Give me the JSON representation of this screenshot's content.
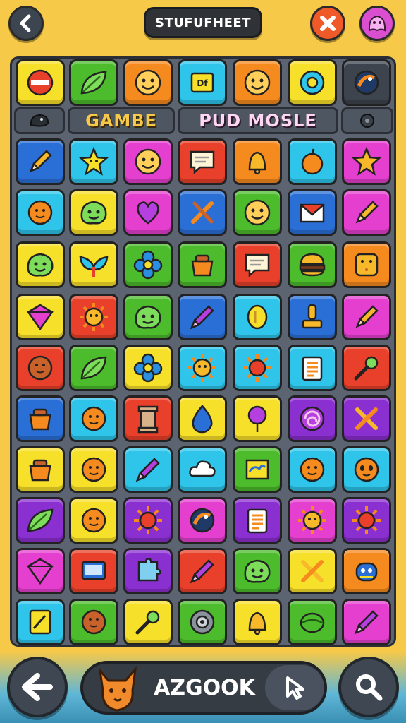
{
  "header": {
    "title": "STUFUFHEET"
  },
  "category_tabs": {
    "left": "GAMBE",
    "right": "PUD MOSLE"
  },
  "footer": {
    "label": "AZGOOK"
  },
  "colors": {
    "yellow": "#f7e02a",
    "orange": "#f58a1f",
    "red": "#e8402a",
    "green": "#4cbb2c",
    "cyan": "#2fc4ea",
    "blue": "#2a6fd6",
    "magenta": "#e43fcf",
    "purple": "#8a2fd0",
    "darkgray": "#3d444e"
  },
  "grid": [
    [
      {
        "c": "yellow",
        "i": "stop-icon"
      },
      {
        "c": "green",
        "i": "leaf-icon"
      },
      {
        "c": "orange",
        "i": "smiley-icon"
      },
      {
        "c": "cyan",
        "i": "sign-icon"
      },
      {
        "c": "orange",
        "i": "smiley-icon"
      },
      {
        "c": "yellow",
        "i": "gear-flower-icon"
      },
      {
        "c": "darkgray",
        "i": "orb-icon"
      }
    ],
    [
      {
        "c": "blue",
        "i": "pencil-icon"
      },
      {
        "c": "cyan",
        "i": "star-face-icon"
      },
      {
        "c": "magenta",
        "i": "smiley-icon"
      },
      {
        "c": "red",
        "i": "chat-icon"
      },
      {
        "c": "orange",
        "i": "bell-icon"
      },
      {
        "c": "cyan",
        "i": "apple-icon"
      },
      {
        "c": "magenta",
        "i": "star-icon"
      }
    ],
    [
      {
        "c": "cyan",
        "i": "ball-icon"
      },
      {
        "c": "yellow",
        "i": "blob-face-icon"
      },
      {
        "c": "magenta",
        "i": "heart-icon"
      },
      {
        "c": "blue",
        "i": "tools-icon"
      },
      {
        "c": "green",
        "i": "smiley-icon"
      },
      {
        "c": "blue",
        "i": "mail-icon"
      },
      {
        "c": "magenta",
        "i": "pencil-icon"
      }
    ],
    [
      {
        "c": "yellow",
        "i": "blob-face-icon"
      },
      {
        "c": "yellow",
        "i": "wings-icon"
      },
      {
        "c": "green",
        "i": "flower-icon"
      },
      {
        "c": "green",
        "i": "pot-icon"
      },
      {
        "c": "red",
        "i": "chat-icon"
      },
      {
        "c": "green",
        "i": "burger-icon"
      },
      {
        "c": "orange",
        "i": "cracker-icon"
      }
    ],
    [
      {
        "c": "yellow",
        "i": "gem-icon"
      },
      {
        "c": "red",
        "i": "sun-face-icon"
      },
      {
        "c": "green",
        "i": "blob-face-icon"
      },
      {
        "c": "blue",
        "i": "crayon-icon"
      },
      {
        "c": "cyan",
        "i": "coin-icon"
      },
      {
        "c": "blue",
        "i": "stamp-icon"
      },
      {
        "c": "magenta",
        "i": "pencil-icon"
      }
    ],
    [
      {
        "c": "red",
        "i": "cookie-icon"
      },
      {
        "c": "green",
        "i": "leaf-icon"
      },
      {
        "c": "yellow",
        "i": "flower-icon"
      },
      {
        "c": "cyan",
        "i": "sun-face-icon"
      },
      {
        "c": "cyan",
        "i": "sun-icon"
      },
      {
        "c": "cyan",
        "i": "list-icon"
      },
      {
        "c": "red",
        "i": "key-icon"
      }
    ],
    [
      {
        "c": "blue",
        "i": "pot-icon"
      },
      {
        "c": "cyan",
        "i": "ball-icon"
      },
      {
        "c": "red",
        "i": "pillar-icon"
      },
      {
        "c": "yellow",
        "i": "drop-icon"
      },
      {
        "c": "yellow",
        "i": "balloon-icon"
      },
      {
        "c": "purple",
        "i": "swirl-icon"
      },
      {
        "c": "purple",
        "i": "cross-tools-icon"
      }
    ],
    [
      {
        "c": "yellow",
        "i": "pot-icon"
      },
      {
        "c": "yellow",
        "i": "ball-icon"
      },
      {
        "c": "cyan",
        "i": "crayon-icon"
      },
      {
        "c": "cyan",
        "i": "cloud-icon"
      },
      {
        "c": "green",
        "i": "map-icon"
      },
      {
        "c": "cyan",
        "i": "ball-icon"
      },
      {
        "c": "cyan",
        "i": "alien-icon"
      }
    ],
    [
      {
        "c": "purple",
        "i": "leaf-icon"
      },
      {
        "c": "yellow",
        "i": "ball-icon"
      },
      {
        "c": "purple",
        "i": "sun-icon"
      },
      {
        "c": "magenta",
        "i": "orb-icon"
      },
      {
        "c": "purple",
        "i": "list-icon"
      },
      {
        "c": "magenta",
        "i": "sun-face-icon"
      },
      {
        "c": "purple",
        "i": "sun-icon"
      }
    ],
    [
      {
        "c": "magenta",
        "i": "gem-icon"
      },
      {
        "c": "red",
        "i": "screen-icon"
      },
      {
        "c": "purple",
        "i": "puzzle-icon"
      },
      {
        "c": "red",
        "i": "crayon-icon"
      },
      {
        "c": "green",
        "i": "blob-face-icon"
      },
      {
        "c": "yellow",
        "i": "cross-tools-icon"
      },
      {
        "c": "orange",
        "i": "robot-icon"
      }
    ],
    [
      {
        "c": "cyan",
        "i": "note-icon"
      },
      {
        "c": "green",
        "i": "cookie-icon"
      },
      {
        "c": "yellow",
        "i": "key-icon"
      },
      {
        "c": "green",
        "i": "tape-icon"
      },
      {
        "c": "yellow",
        "i": "bell-icon"
      },
      {
        "c": "green",
        "i": "melon-icon"
      },
      {
        "c": "magenta",
        "i": "crayon-icon"
      }
    ]
  ]
}
